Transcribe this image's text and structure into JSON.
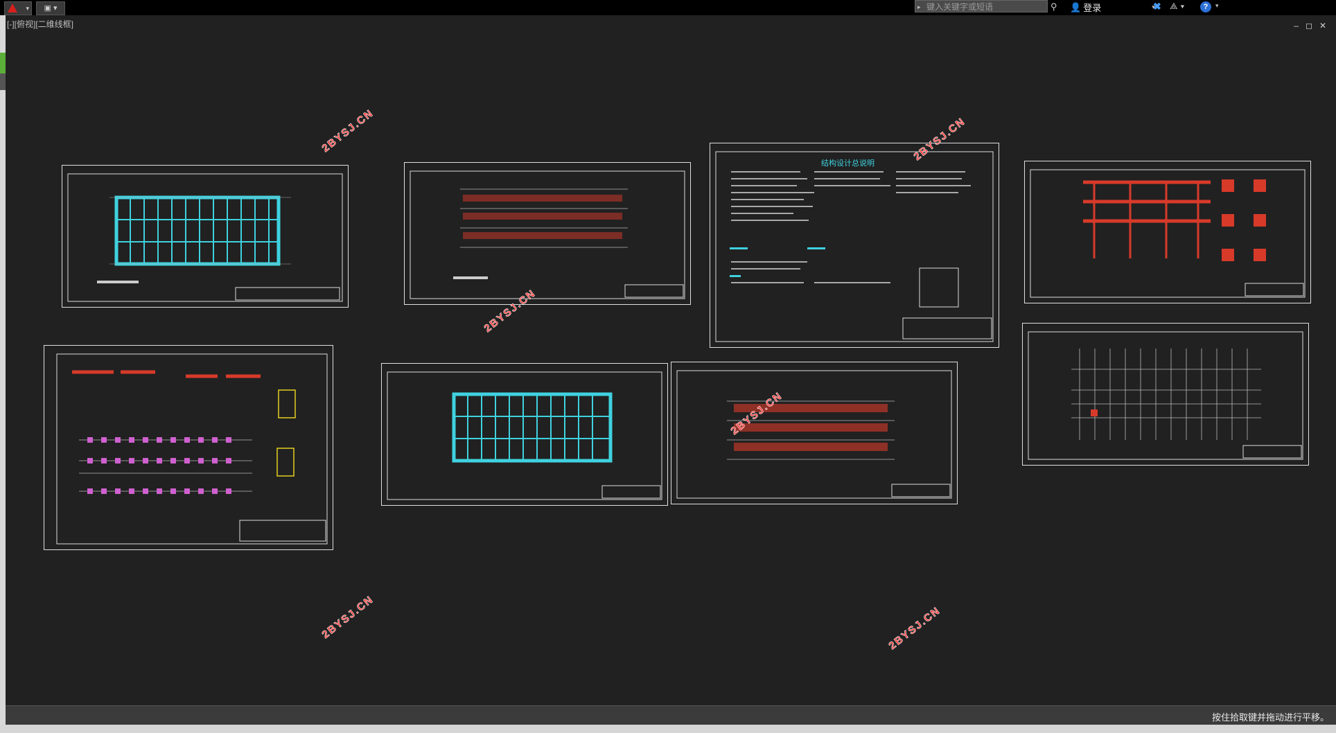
{
  "titlebar": {
    "quick_access_icon": "save-icon",
    "search_placeholder": "键入关键字或短语",
    "login_label": "登录",
    "help_label": "?"
  },
  "viewport": {
    "label": "[-][俯视][二维线框]"
  },
  "window_controls": [
    "–",
    "◻",
    "✕"
  ],
  "watermarks": [
    "2BYSJ.CN",
    "2BYSJ.CN",
    "2BYSJ.CN",
    "2BYSJ.CN",
    "2BYSJ.CN",
    "2BYSJ.CN"
  ],
  "sheet_6_title": "结构设计总说明",
  "status": {
    "message": "按住拾取键并拖动进行平移。"
  },
  "colors": {
    "background": "#212121",
    "titlebar": "#000000",
    "watermark": "#ff2a2a",
    "cyan": "#3fd2e0",
    "red": "#d83a2a",
    "yellow": "#e6d020",
    "magenta": "#d060d0"
  }
}
